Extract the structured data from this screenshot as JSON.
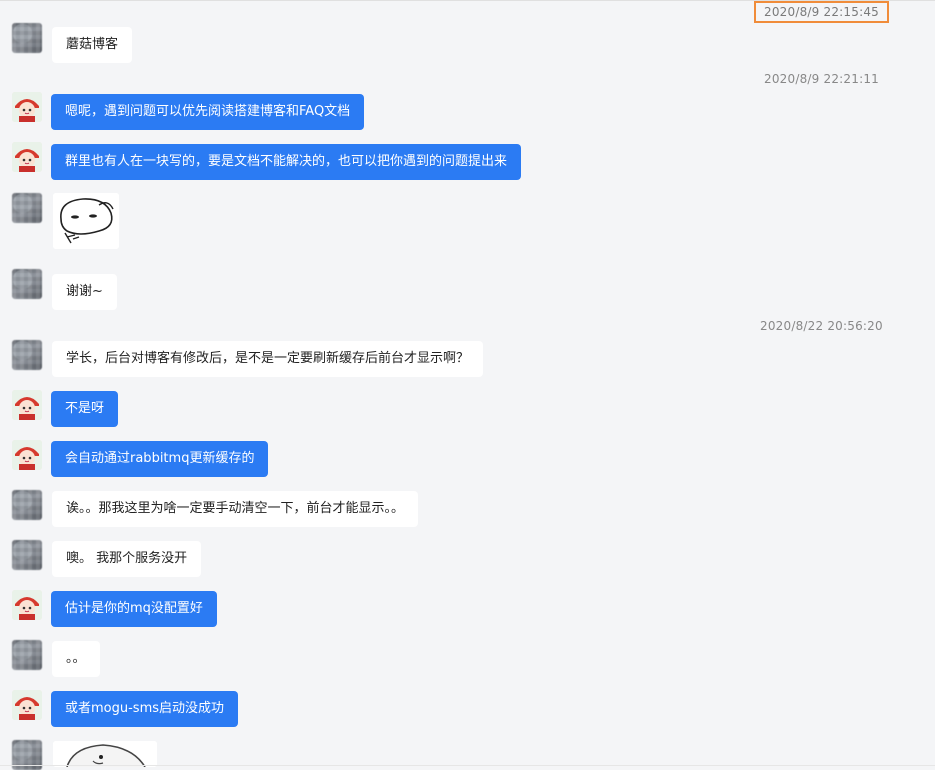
{
  "chat": {
    "timestamps": [
      "2020/8/9 22:15:45",
      "2020/8/9 22:21:11",
      "2020/8/22 20:56:20"
    ],
    "messages": [
      "蘑菇博客",
      "嗯呢，遇到问题可以优先阅读搭建博客和FAQ文档",
      "群里也有人在一块写的，要是文档不能解决的，也可以把你遇到的问题提出来",
      "谢谢~",
      "学长，后台对博客有修改后，是不是一定要刷新缓存后前台才显示啊？",
      "不是呀",
      "会自动通过rabbitmq更新缓存的",
      "诶。。那我这里为啥一定要手动清空一下，前台才能显示。。",
      "噢。 我那个服务没开",
      "估计是你的mq没配置好",
      "。。",
      "或者mogu-sms启动没成功"
    ]
  },
  "colors": {
    "outgoing_bubble": "#2b7bf3",
    "incoming_bubble": "#ffffff",
    "background": "#f4f5f7",
    "highlight_border": "#f08c3a"
  }
}
